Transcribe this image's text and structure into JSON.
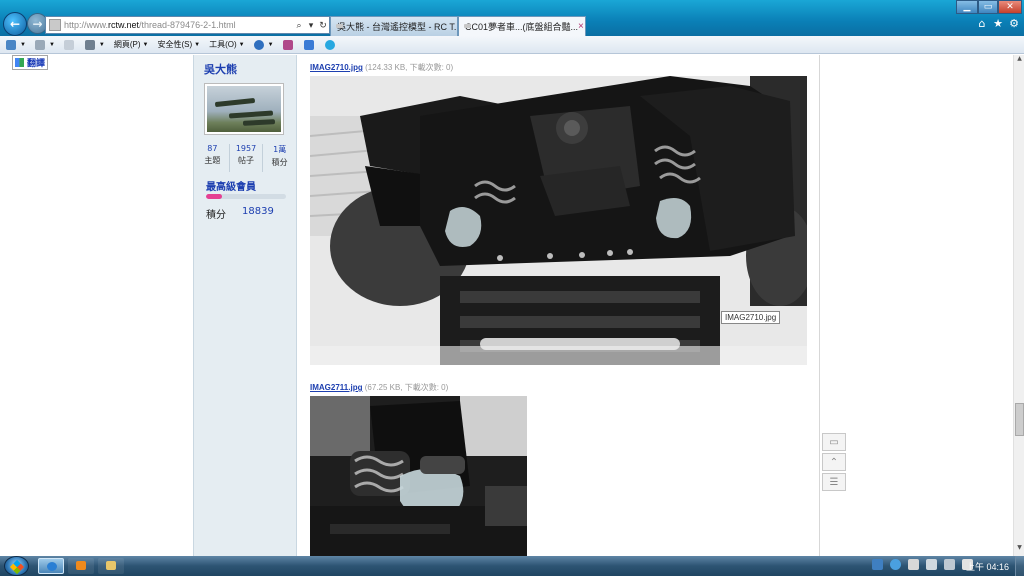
{
  "browser": {
    "address_url_prefix": "http://www.",
    "address_url_domain": "rctw.net",
    "address_url_path": "/thread-879476-2-1.html",
    "tabs": [
      {
        "label": "吳大熊 - 台灣遙控模型 - RC T..."
      },
      {
        "label": "CC01夢者車...(底盤組合豔..."
      }
    ],
    "right_icons": [
      "home-icon",
      "star-icon",
      "gear-icon"
    ]
  },
  "command_bar": {
    "page_menu": "網頁(P)",
    "safety_menu": "安全性(S)",
    "tools_menu": "工具(O)"
  },
  "page": {
    "translate_label": "翻譯",
    "user": {
      "name": "吳大熊",
      "stats": [
        {
          "num": "87",
          "label": "主題"
        },
        {
          "num": "1957",
          "label": "帖子"
        },
        {
          "num": "1萬",
          "label": "積分"
        }
      ],
      "rank": "最高級會員",
      "rank_progress": 0.2,
      "points_label": "積分",
      "points_value": "18839"
    },
    "attachments": [
      {
        "name": "IMAG2710.jpg",
        "meta": "(124.33 KB, 下載次數: 0)"
      },
      {
        "name": "IMAG2711.jpg",
        "meta": "(67.25 KB, 下載次數: 0)"
      }
    ],
    "tooltip": "IMAG2710.jpg"
  },
  "taskbar": {
    "clock": "上午 04:16"
  },
  "colors": {
    "link": "#1d3fb0",
    "rank_bar": "#e53f92",
    "panel_bg": "#e5edf2"
  }
}
